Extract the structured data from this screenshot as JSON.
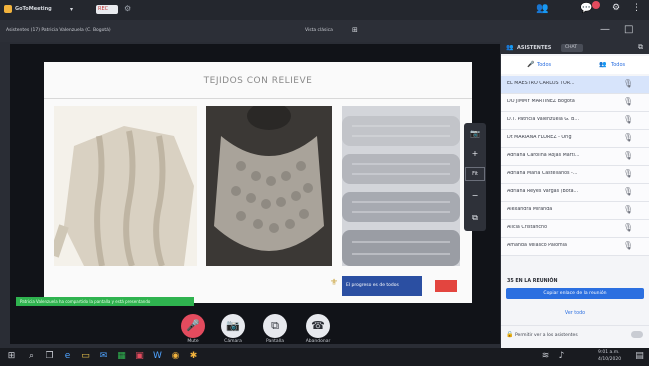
{
  "app": {
    "title": "GoToMeeting",
    "rec_badge": "REC"
  },
  "subbar": {
    "meeting_name": "Asistentes (17) Patricia Valenzuela (C. Bogotá)",
    "view_label": "Vista clásica",
    "view_icon": "grid-icon"
  },
  "slide": {
    "title": "TEJIDOS CON RELIEVE",
    "logo_text": "El progreso es de todos"
  },
  "status_bar": {
    "text": "Patricia Valenzuela ha compartido la pantalla y está presentando"
  },
  "controls": [
    {
      "name": "mute-button",
      "label": "Mute",
      "icon": "mic-icon",
      "glyph": "🎤",
      "active": true
    },
    {
      "name": "camera-button",
      "label": "Cámara",
      "icon": "camera-icon",
      "glyph": "📷",
      "active": false
    },
    {
      "name": "screen-button",
      "label": "Pantalla",
      "icon": "screen-icon",
      "glyph": "⧉",
      "active": false
    },
    {
      "name": "leave-button",
      "label": "Abandonar",
      "icon": "phone-icon",
      "glyph": "☎",
      "active": false
    }
  ],
  "panel": {
    "tab_participants": "ASISTENTES",
    "tab_chat": "CHAT",
    "filter_speakers": "Todos",
    "filter_all": "Todos",
    "participants": [
      "EL MAESTRO CARLOS TOR...",
      "DO JIMMY MARTINEZ Bogotá",
      "D.T. Patricia Valenzuela G. B...",
      "Dt MARIANA FLOREZ - Orig",
      "Adriana Carolina Rojas Martí...",
      "Adriana María Castellanos -...",
      "Adriana Reyes Vargas (Bota...",
      "Alexandra Miranda",
      "Alicia Cristancho",
      "Amanda Velasco Palomia"
    ],
    "footer_room": "35 EN LA REUNIÓN",
    "invite_button": "Copiar enlace de la reunión",
    "view_link": "Ver todo",
    "settings_text": "Permitir ver a los asistentes"
  },
  "taskbar": {
    "time": "9:01 a.m.",
    "date": "4/10/2020"
  },
  "colors": {
    "accent": "#2b6fe0",
    "mute_red": "#e34b5e",
    "panel_bg": "#f4f5f8",
    "status_green": "#2fb34f"
  }
}
